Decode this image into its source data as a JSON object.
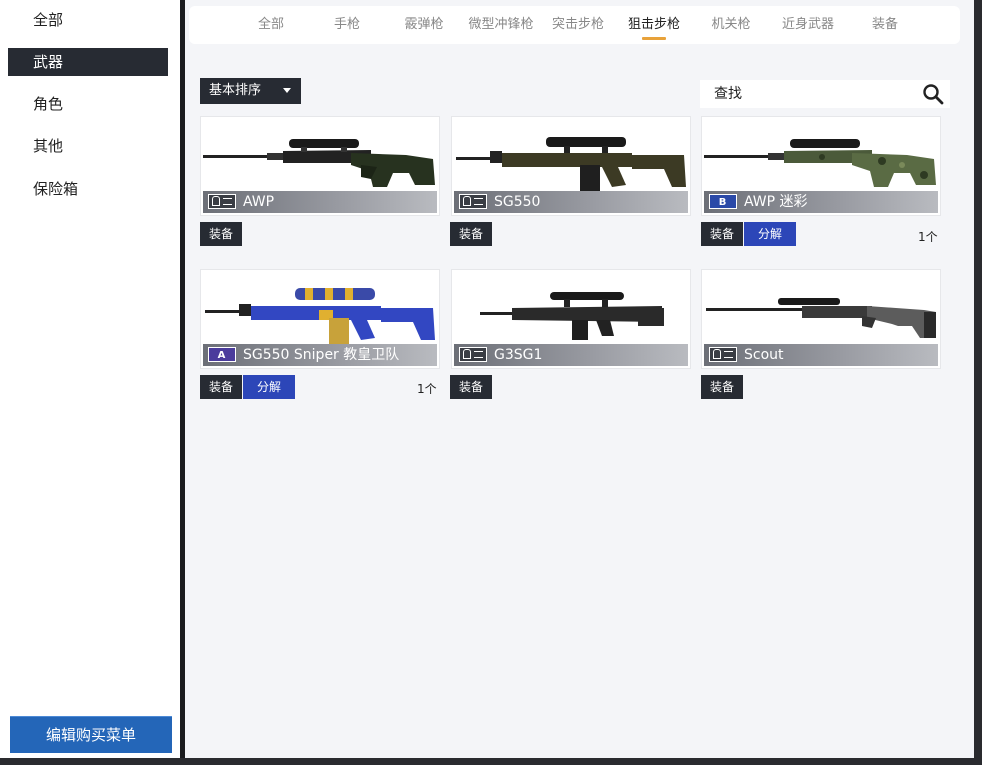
{
  "sidebar": {
    "items": [
      {
        "label": "全部",
        "active": false
      },
      {
        "label": "武器",
        "active": true
      },
      {
        "label": "角色",
        "active": false
      },
      {
        "label": "其他",
        "active": false
      },
      {
        "label": "保险箱",
        "active": false
      }
    ],
    "edit_menu_label": "编辑购买菜单"
  },
  "tabs": [
    {
      "label": "全部",
      "active": false
    },
    {
      "label": "手枪",
      "active": false
    },
    {
      "label": "霰弹枪",
      "active": false
    },
    {
      "label": "微型冲锋枪",
      "active": false
    },
    {
      "label": "突击步枪",
      "active": false
    },
    {
      "label": "狙击步枪",
      "active": true
    },
    {
      "label": "机关枪",
      "active": false
    },
    {
      "label": "近身武器",
      "active": false
    },
    {
      "label": "装备",
      "active": false
    }
  ],
  "toolbar": {
    "sort_label": "基本排序",
    "search_placeholder": "查找"
  },
  "items": [
    {
      "name": "AWP",
      "rank_icon": "id-badge-icon",
      "rank_letter": "",
      "equip_label": "装备",
      "decompose_label": "",
      "count": ""
    },
    {
      "name": "SG550",
      "rank_icon": "id-badge-icon",
      "rank_letter": "",
      "equip_label": "装备",
      "decompose_label": "",
      "count": ""
    },
    {
      "name": "AWP 迷彩",
      "rank_icon": "rank-b-icon",
      "rank_letter": "B",
      "equip_label": "装备",
      "decompose_label": "分解",
      "count": "1个"
    },
    {
      "name": "SG550 Sniper 教皇卫队",
      "rank_icon": "rank-a-icon",
      "rank_letter": "A",
      "equip_label": "装备",
      "decompose_label": "分解",
      "count": "1个"
    },
    {
      "name": "G3SG1",
      "rank_icon": "id-badge-icon",
      "rank_letter": "",
      "equip_label": "装备",
      "decompose_label": "",
      "count": ""
    },
    {
      "name": "Scout",
      "rank_icon": "id-badge-icon",
      "rank_letter": "",
      "equip_label": "装备",
      "decompose_label": "",
      "count": ""
    }
  ],
  "colors": {
    "accent": "#e8a23a",
    "dark": "#272b33",
    "decompose": "#2c46b8",
    "edit_button": "#2466b8"
  }
}
